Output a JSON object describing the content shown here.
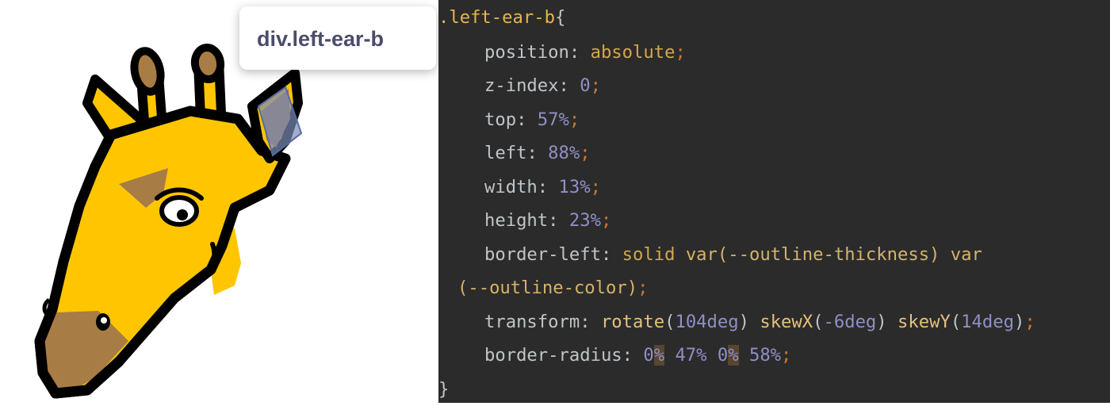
{
  "preview": {
    "tooltip": "div.left-ear-b"
  },
  "code": {
    "selector": ".left-ear-b",
    "open_brace": "{",
    "close_brace": "}",
    "l_position_prop": "position",
    "l_position_val": "absolute",
    "l_zindex_prop": "z-index",
    "l_zindex_val": "0",
    "l_top_prop": "top",
    "l_top_val": "57%",
    "l_left_prop": "left",
    "l_left_val": "88%",
    "l_width_prop": "width",
    "l_width_val": "13%",
    "l_height_prop": "height",
    "l_height_val": "23%",
    "l_border_prop": "border-left",
    "l_border_solid": "solid",
    "l_border_var1": "var(--outline-thickness)",
    "l_border_var2": "var",
    "l_border_cont": "(--outline-color)",
    "l_transform_prop": "transform",
    "l_transform_rotate_fn": "rotate",
    "l_transform_rotate_arg": "104deg",
    "l_transform_skewx_fn": "skewX",
    "l_transform_skewx_arg": "-6deg",
    "l_transform_skewy_fn": "skewY",
    "l_transform_skewy_arg": "14deg",
    "l_radius_prop": "border-radius",
    "l_radius_v1a": "0",
    "l_radius_v1b": "%",
    "l_radius_v2": "47%",
    "l_radius_v3a": "0",
    "l_radius_v3b": "%",
    "l_radius_v4": "58%"
  },
  "colors": {
    "giraffe_yellow": "#ffc600",
    "giraffe_brown": "#a87c45",
    "outline": "#000000",
    "editor_bg": "#2b2b2b",
    "highlight_overlay": "#7b8cb8"
  }
}
